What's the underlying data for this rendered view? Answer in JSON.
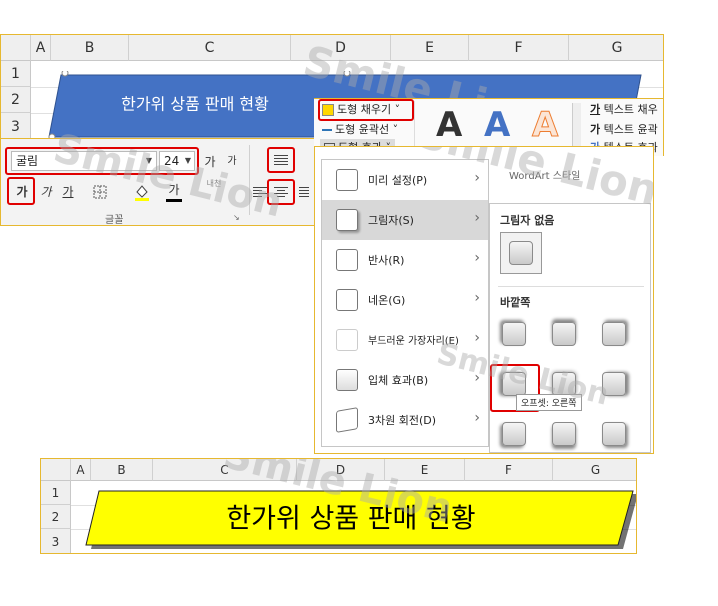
{
  "top_sheet": {
    "columns": [
      "A",
      "B",
      "C",
      "D",
      "E",
      "F",
      "G"
    ],
    "rows": [
      "1",
      "2",
      "3"
    ],
    "shape_text": "한가위 상품 판매 현황",
    "shape_color": "#4472c4"
  },
  "font_group": {
    "font_name": "굴림",
    "font_size": "24",
    "grow_font": "가",
    "shrink_font": "가",
    "bold_label": "가",
    "italic_label": "가",
    "underline_label": "가",
    "font_color_label": "가",
    "phonetic_label": "내천",
    "group_label": "글꼴"
  },
  "shape_format": {
    "fill_label": "도형 채우기",
    "outline_label": "도형 윤곽선",
    "effects_label": "도형 효과",
    "wordart_letters": [
      "A",
      "A",
      "A"
    ],
    "text_fill_label": "텍스트 채우",
    "text_outline_label": "텍스트 윤곽",
    "text_effects_label": "텍스트 효과",
    "text_glyph": "가",
    "wordart_group_label": "WordArt 스타일"
  },
  "effects_menu": {
    "items": [
      {
        "label": "미리 설정(P)"
      },
      {
        "label": "그림자(S)"
      },
      {
        "label": "반사(R)"
      },
      {
        "label": "네온(G)"
      },
      {
        "label": "부드러운 가장자리(E)"
      },
      {
        "label": "입체 효과(B)"
      },
      {
        "label": "3차원 회전(D)"
      }
    ],
    "selected_index": 1
  },
  "shadow_gallery": {
    "no_shadow_label": "그림자 없음",
    "outer_label": "바깥쪽",
    "tooltip": "오프셋: 오른쪽"
  },
  "result_sheet": {
    "columns": [
      "A",
      "B",
      "C",
      "D",
      "E",
      "F",
      "G"
    ],
    "rows": [
      "1",
      "2",
      "3"
    ],
    "shape_text": "한가위 상품 판매 현황",
    "shape_color": "#ffff00"
  },
  "watermark": "Smile Lion"
}
